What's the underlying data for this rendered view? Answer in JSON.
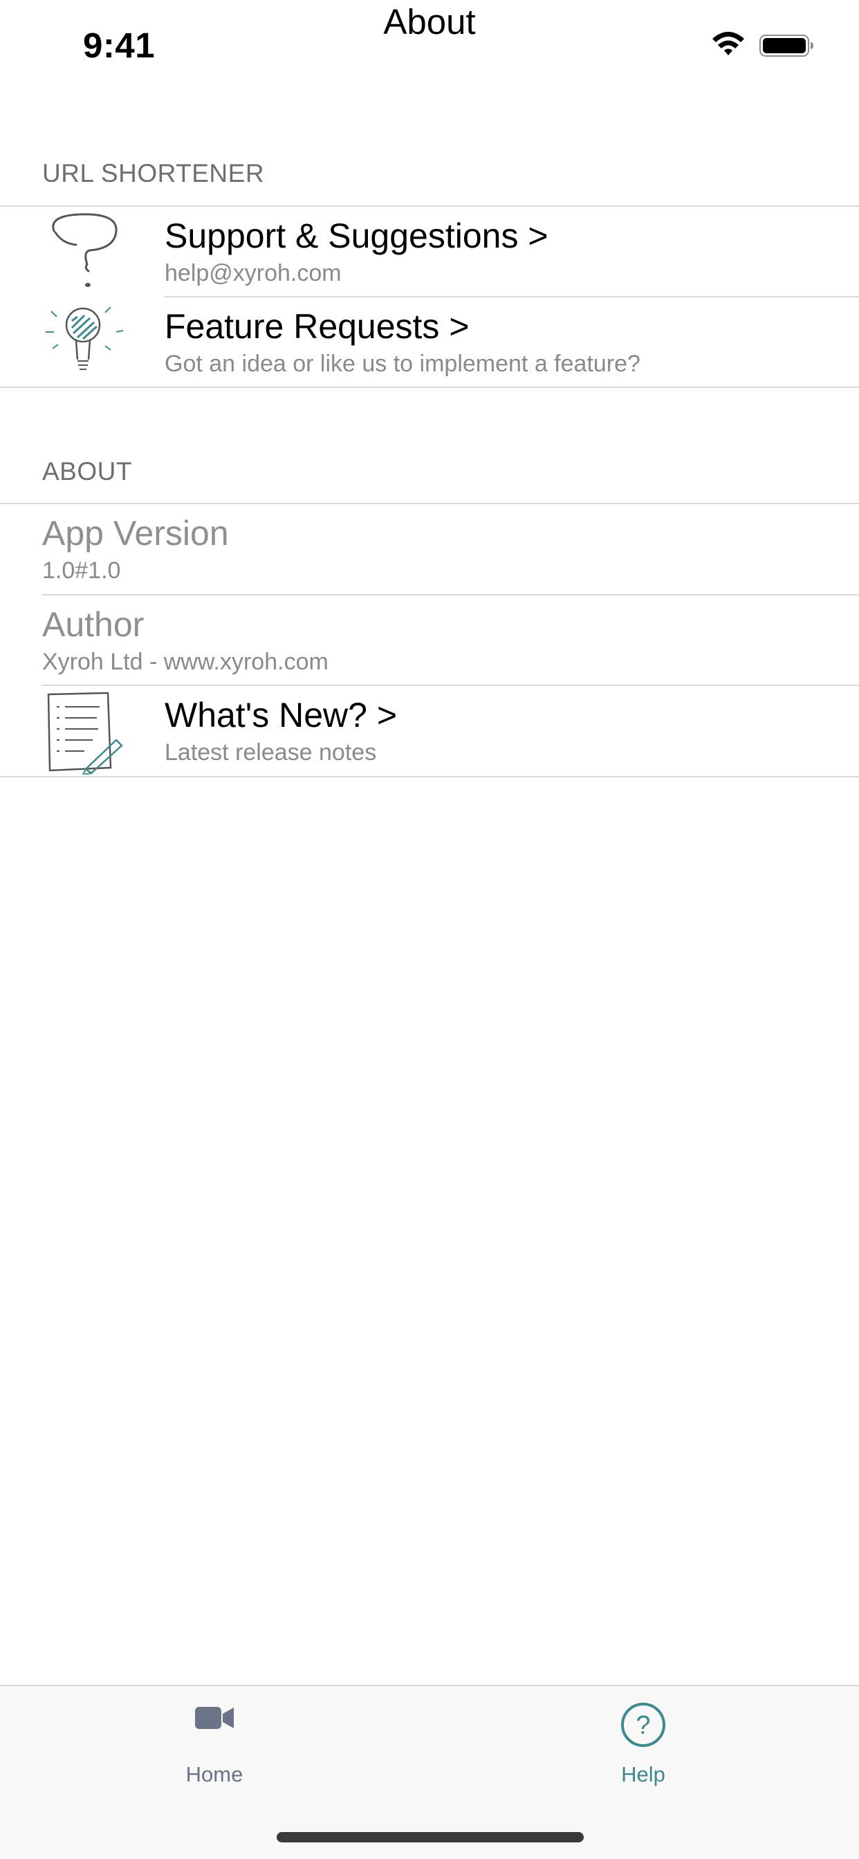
{
  "status": {
    "time": "9:41"
  },
  "nav": {
    "title": "About"
  },
  "sections": {
    "shortener": {
      "header": "URL SHORTENER",
      "rows": [
        {
          "title": "Support & Suggestions >",
          "subtitle": "help@xyroh.com",
          "icon": "question-mark-sketch-icon"
        },
        {
          "title": "Feature Requests >",
          "subtitle": "Got an idea or like us to implement a feature?",
          "icon": "lightbulb-sketch-icon"
        }
      ]
    },
    "about": {
      "header": "ABOUT",
      "rows": [
        {
          "title": "App Version",
          "subtitle": "1.0#1.0"
        },
        {
          "title": "Author",
          "subtitle": "Xyroh Ltd - www.xyroh.com"
        },
        {
          "title": "What's New? >",
          "subtitle": "Latest release notes",
          "icon": "notes-sketch-icon"
        }
      ]
    }
  },
  "tabbar": {
    "tabs": [
      {
        "label": "Home",
        "icon": "video-camera-icon",
        "selected": false
      },
      {
        "label": "Help",
        "icon": "help-circle-icon",
        "selected": true
      }
    ]
  },
  "colors": {
    "accent": "#3e8a8a",
    "inactive_tab": "#6a7486"
  }
}
